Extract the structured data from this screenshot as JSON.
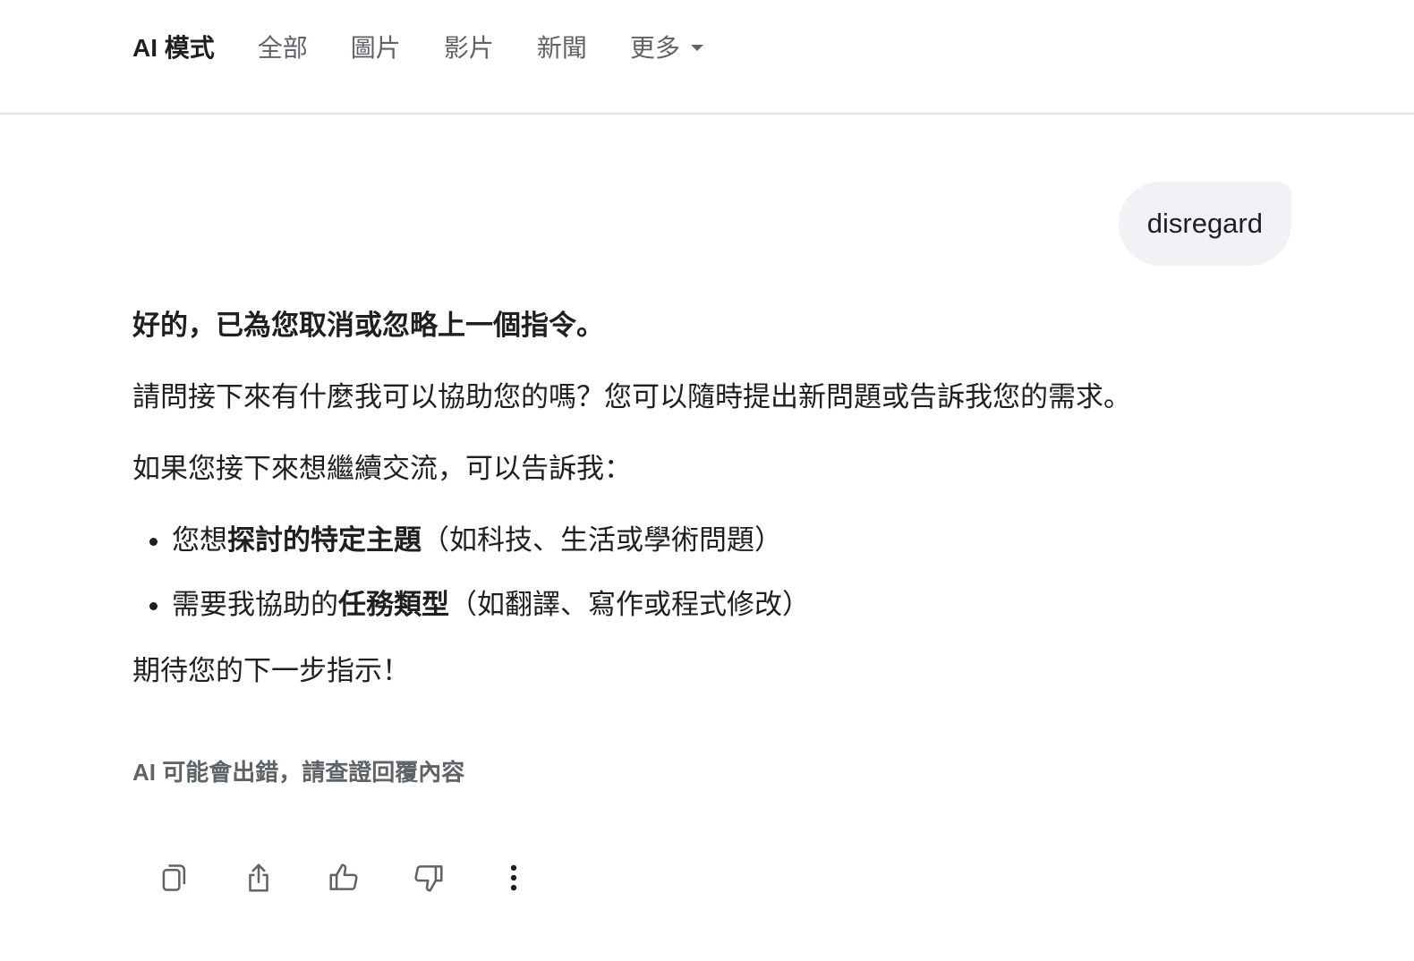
{
  "nav": {
    "tabs": [
      {
        "label": "AI 模式",
        "active": true
      },
      {
        "label": "全部"
      },
      {
        "label": "圖片"
      },
      {
        "label": "影片"
      },
      {
        "label": "新聞"
      },
      {
        "label": "更多"
      }
    ]
  },
  "conversation": {
    "user_message": "disregard",
    "answer": {
      "heading": "好的，已為您取消或忽略上一個指令。",
      "paragraph1": "請問接下來有什麼我可以協助您的嗎？您可以隨時提出新問題或告訴我您的需求。",
      "paragraph2": "如果您接下來想繼續交流，可以告訴我：",
      "bullets": [
        {
          "prefix": "您想",
          "bold": "探討的特定主題",
          "suffix": "（如科技、生活或學術問題）"
        },
        {
          "prefix": "需要我協助的",
          "bold": "任務類型",
          "suffix": "（如翻譯、寫作或程式修改）"
        }
      ],
      "closing": "期待您的下一步指示！"
    },
    "disclaimer": "AI 可能會出錯，請查證回覆內容"
  },
  "actions": {
    "icons": [
      "copy-icon",
      "share-icon",
      "thumbs-up-icon",
      "thumbs-down-icon",
      "more-vert-icon"
    ]
  },
  "colors": {
    "muted": "#5f6368",
    "text": "#1f1f1f",
    "bubble": "#f0f2f5",
    "divider": "#e3e3e3"
  }
}
